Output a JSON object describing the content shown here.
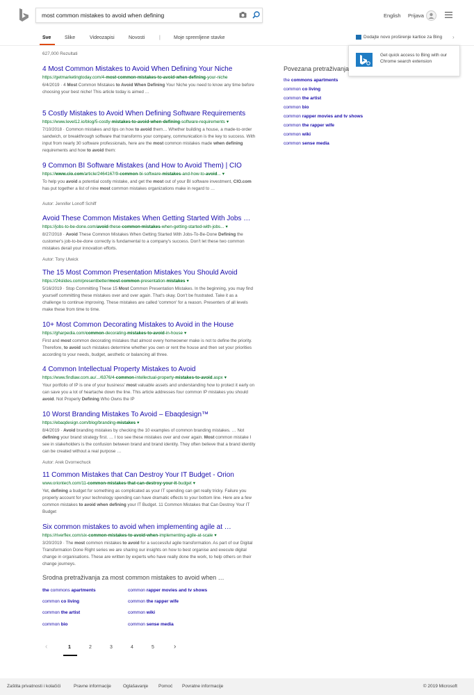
{
  "header": {
    "logo": "bing-logo-icon",
    "search_value": "most common mistakes to avoid when defining",
    "lang": "English",
    "signin": "Prijava"
  },
  "tabs": [
    {
      "label": "Sve",
      "active": true
    },
    {
      "label": "Slike"
    },
    {
      "label": "Videozapisi"
    },
    {
      "label": "Novosti"
    },
    {
      "label": "Moje spremljene stavke"
    }
  ],
  "tab_separator": "|",
  "ext_promo": "Dodajte novo proširenje kartice za Bing",
  "popup": {
    "text": "Get quick access to Bing with our Chrome search extension"
  },
  "result_count": "627,000 Rezultati",
  "results": [
    {
      "title": "4 Most Common Mistakes to Avoid When Defining Your Niche",
      "url_html": "https://getmarketingtoday.com/4-<b>most-common-mistakes-to-avoid-when-defining</b>-your-niche",
      "snippet_html": "6/4/2019 · 4 <b>Most</b> Common Mistakes <b>to Avoid When Defining</b> Your Niche you need to know any time before choosing your best niche! This article today is aimed …",
      "author": ""
    },
    {
      "title": "5 Costly Mistakes to Avoid When Defining Software Requirements",
      "url_html": "https://www.level12.io/blog/5-costly-<b>mistakes-to-avoid-when-defining</b>-software-requirements",
      "snippet_html": "7/10/2018 · Common mistakes and tips on how <b>to avoid</b> them… Whether building a house, a made-to-order sandwich, or breakthrough software that transforms your company, communication is the key to success. With input from nearly 30 software professionals, here are the <b>most</b> common mistakes made <b>when defining</b> requirements and how <b>to avoid</b> them:",
      "author": ""
    },
    {
      "title": "9 Common BI Software Mistakes (and How to Avoid Them) | CIO",
      "url_html": "https://<b>www.cio.com</b>/article/2464167/9-<b>common</b>-bi-software-<b>mistakes</b>-and-how-to-<b>avoid</b>...",
      "snippet_html": "To help you <b>avoid</b> a potential costly mistake, and get the <b>most</b> out of your BI software investment, <b>CIO.com</b> has put together a list of nine <b>most</b> common mistakes organizations make in regard to …",
      "author": "Autor: Jennifer Lonoff Schiff"
    },
    {
      "title": "Avoid These Common Mistakes When Getting Started With Jobs …",
      "url_html": "https://jobs-to-be-done.com/<b>avoid</b>-these-<b>common-mistakes</b>-when-getting-started-with-jobs...",
      "snippet_html": "8/27/2018 · <b>Avoid</b> These Common Mistakes When Getting Started With Jobs-To-Be-Done <b>Defining</b> the customer's job-to-be-done correctly is fundamental to a company's success. Don't let these two common mistakes derail your innovation efforts.",
      "author": "Autor: Tony Ulwick"
    },
    {
      "title": "The 15 Most Common Presentation Mistakes You Should Avoid",
      "url_html": "https://24slides.com/presentbetter/<b>most</b>-<b>common</b>-presentation-<b>mistakes</b>",
      "snippet_html": "5/16/2019 · Stop Committing These 15 <b>Most</b> Common Presentation Mistakes. In the beginning, you may find yourself committing these mistakes over and over again. That's okay. Don't be frustrated. Take it as a challenge to continue improving. These mistakes are called 'common' for a reason. Presenters of all levels make these from time to time.",
      "author": ""
    },
    {
      "title": "10+ Most Common Decorating Mistakes to Avoid in the House",
      "url_html": "https://gharpedia.com/<b>common</b>-decorating-<b>mistakes-to-avoid</b>-in-house",
      "snippet_html": "First and <b>most</b> common decorating mistakes that almost every homeowner make is not to define the priority. Therefore, <b>to avoid</b> such mistakes determine whether you own or rent the house and then set your priorities according to your needs, budget, aesthetic or balancing all three.",
      "author": ""
    },
    {
      "title": "4 Common Intellectual Property Mistakes to Avoid",
      "url_html": "https://www.findlaw.com.au/.../6376/4-<b>common</b>-intellectual-property-<b>mistakes-to-avoid</b>.aspx",
      "snippet_html": "Your portfolio of IP is one of your business' <b>most</b> valuable assets and understanding how to protect it early on can save you a lot of heartache down the line. This article addresses four common IP mistakes you should <b>avoid</b>. Not Properly <b>Defining</b> Who Owns the IP",
      "author": ""
    },
    {
      "title": "10 Worst Branding Mistakes To Avoid – Ebaqdesign™",
      "url_html": "https://ebaqdesign.com/blog/branding-<b>mistakes</b>",
      "snippet_html": "8/4/2019 · <b>Avoid</b> branding mistakes by checking the 10 examples of common branding mistakes. … Not <b>defining</b> your brand strategy first. … I too see these mistakes over and over again. <b>Most</b> common mistake I see in stakeholders is the confusion between brand and brand identity. They often believe that a brand identity can be created without a real purpose …",
      "author": "Autor: Arek Dvornechuck"
    },
    {
      "title": "11 Common Mistakes that Can Destroy Your IT Budget - Orion",
      "url_html": "www.oriontech.com/11-<b>common-mistakes-that-can-destroy-your-it</b>-budget",
      "snippet_html": "Yet, <b>defining</b> a budget for something as complicated as your IT spending can get really tricky. Failure you properly account for your technology spending can have dramatic effects to your bottom line. Here are a few common mistakes <b>to avoid when defining</b> your IT Budget. 11 Common Mistakes that Can Destroy Your IT Budget",
      "author": ""
    },
    {
      "title": "Six common mistakes to avoid when implementing agile at …",
      "url_html": "https://riverflex.com/six-<b>common-mistakes-to-avoid-when</b>-implementing-agile-at-scale",
      "snippet_html": "3/20/2019 · The <b>most</b> common mistakes <b>to avoid</b> for a successful agile transformation. As part of our Digital Transformation Done Right series we are sharing our insights on how to best organise and execute digital change in organisations. These are written by experts who have really done the work, to help others on their change journeys.",
      "author": ""
    }
  ],
  "right_rail": {
    "title": "Povezana pretraživanja",
    "items_html": [
      "the <b>commons apartments</b>",
      "common <b>co living</b>",
      "common <b>the artist</b>",
      "common <b>bio</b>",
      "common <b>rapper movies and tv shows</b>",
      "common <b>the rapper wife</b>",
      "common <b>wiki</b>",
      "common <b>sense media</b>"
    ]
  },
  "related": {
    "title": "Srodna pretraživanja za most common mistakes to avoid when …",
    "left_html": [
      "<b>the</b> commons <b>apartments</b>",
      "common <b>co living</b>",
      "common <b>the artist</b>",
      "common <b>bio</b>"
    ],
    "right_html": [
      "common <b>rapper movies and tv shows</b>",
      "common <b>the rapper wife</b>",
      "common <b>wiki</b>",
      "common <b>sense media</b>"
    ]
  },
  "pagination": {
    "prev": "‹",
    "pages": [
      "1",
      "2",
      "3",
      "4",
      "5"
    ],
    "current": "1",
    "next": "›"
  },
  "footer": {
    "links": [
      "Zaštita privatnosti i kolačići",
      "Pravne informacije",
      "Oglašavanje",
      "Pomoć",
      "Povratne informacije"
    ],
    "copyright": "© 2019 Microsoft"
  },
  "colors": {
    "accent": "#de4a13",
    "link": "#1a0dab",
    "url_green": "#006d21"
  }
}
